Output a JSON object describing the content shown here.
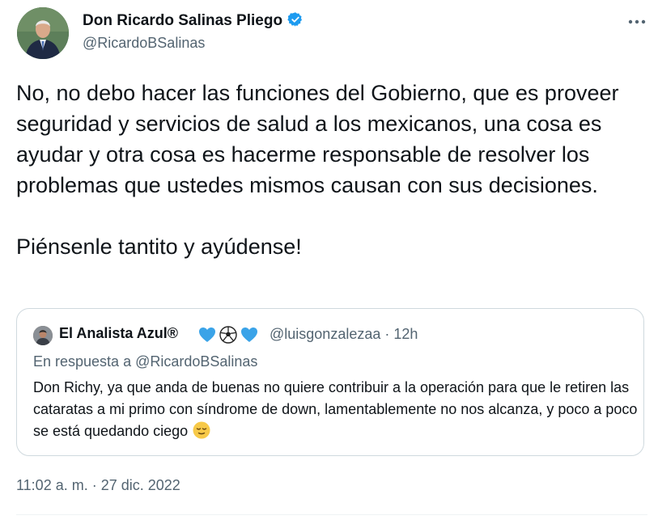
{
  "author": {
    "name": "Don Ricardo Salinas Pliego",
    "handle": "@RicardoBSalinas",
    "verified_color": "#1d9bf0"
  },
  "tweet": {
    "paragraph1": "No, no debo hacer las funciones del Gobierno, que es proveer seguridad y servicios de salud a los mexicanos, una cosa es ayudar y otra cosa es hacerme responsable de resolver los problemas que ustedes mismos causan con sus decisiones.",
    "paragraph2": "Piénsenle tantito y ayúdense!"
  },
  "quoted": {
    "name": "El Analista Azul®",
    "name_emojis": [
      "blue-heart-icon",
      "soccer-ball-icon",
      "blue-heart-icon"
    ],
    "handle_time": "@luisgonzalezaa · 12h",
    "reply_to": "En respuesta a @RicardoBSalinas",
    "text": "Don Richy, ya que anda de buenas no quiere contribuir a la operación para que le retiren las cataratas a mi primo con síndrome de down, lamentablemente no nos alcanza, y poco a poco se está quedando ciego",
    "trailing_emoji": "relieved-face-icon"
  },
  "timestamp": "11:02 a. m. · 27 dic. 2022",
  "colors": {
    "text": "#0f1419",
    "secondary": "#536471",
    "border": "#cfd9de",
    "accent": "#1d9bf0"
  }
}
